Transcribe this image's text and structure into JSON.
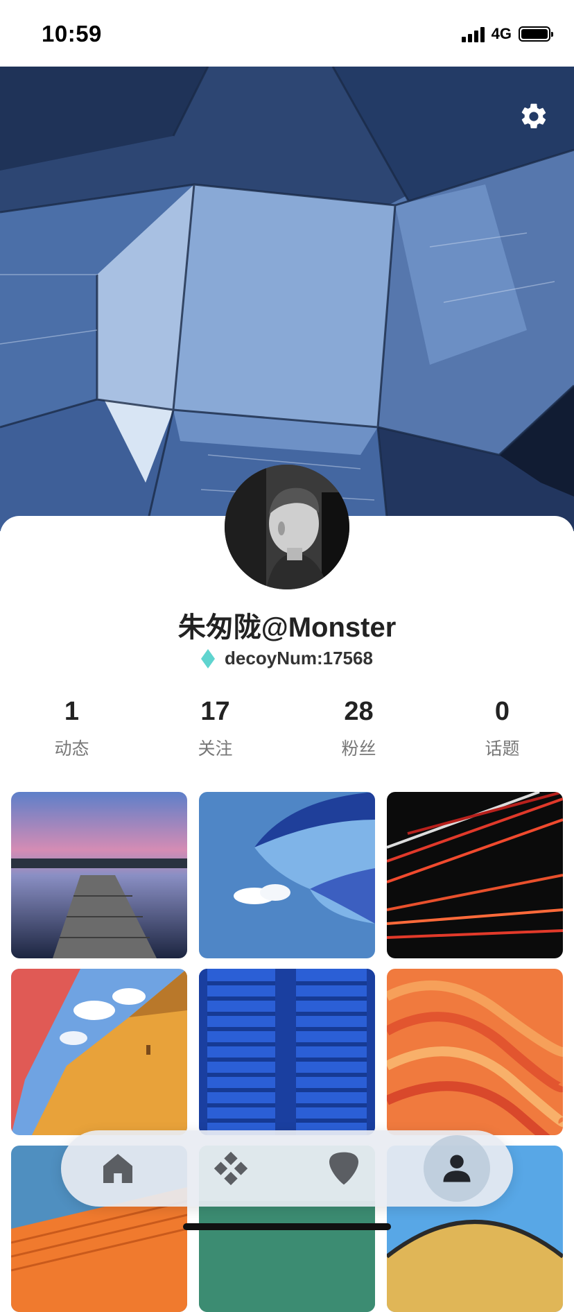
{
  "status_bar": {
    "time": "10:59",
    "network": "4G"
  },
  "profile": {
    "name": "朱匆陇@Monster",
    "decoy": "decoyNum:17568",
    "accent_color": "#5fd4cf"
  },
  "stats": [
    {
      "value": "1",
      "label": "动态"
    },
    {
      "value": "17",
      "label": "关注"
    },
    {
      "value": "28",
      "label": "粉丝"
    },
    {
      "value": "0",
      "label": "话题"
    }
  ],
  "grid": {
    "tiles": [
      {
        "subject": "pier-sunset"
      },
      {
        "subject": "blue-umbrella-sky"
      },
      {
        "subject": "light-trails"
      },
      {
        "subject": "colorful-building-sky"
      },
      {
        "subject": "blue-shutters"
      },
      {
        "subject": "orange-waves"
      },
      {
        "subject": "orange-roof"
      },
      {
        "subject": "green-wall"
      },
      {
        "subject": "arch-structure"
      }
    ]
  },
  "nav": {
    "items": [
      {
        "icon": "home-icon",
        "active": false
      },
      {
        "icon": "discover-icon",
        "active": false
      },
      {
        "icon": "pick-icon",
        "active": false
      },
      {
        "icon": "user-icon",
        "active": true
      }
    ]
  },
  "icons": {
    "settings": "gear-icon",
    "decoy": "diamond-icon"
  }
}
